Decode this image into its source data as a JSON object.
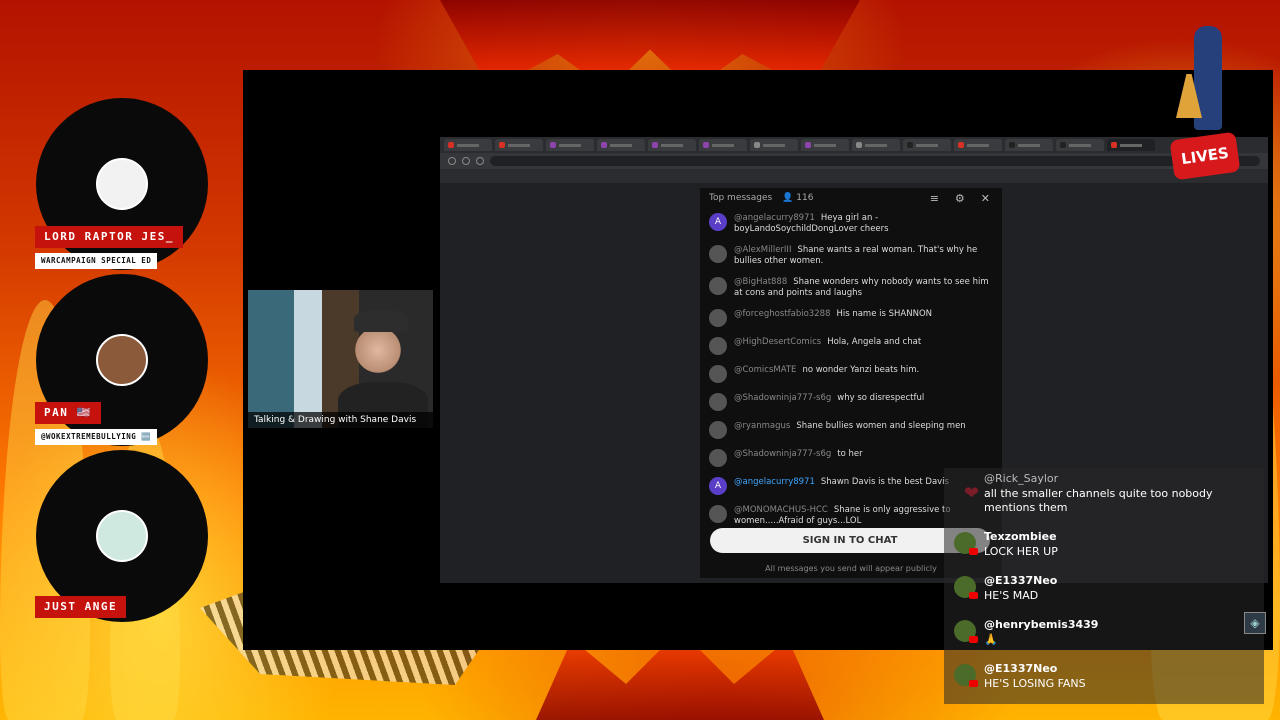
{
  "stream": {
    "browser_tabs": 16,
    "webcam_caption": "Talking & Drawing with Shane Davis",
    "lives_badge": "LIVES"
  },
  "yt_chat": {
    "header_title": "Top messages",
    "viewer_count": "116",
    "messages": [
      {
        "avatar": "A",
        "author": "@angelacurry8971",
        "text": "Heya girl an -boyLandoSoychildDongLover cheers",
        "blue": false
      },
      {
        "avatar": "",
        "author": "@AlexMillerIII",
        "text": "Shane wants a real woman. That's why he bullies other women.",
        "blue": false
      },
      {
        "avatar": "",
        "author": "@BigHat888",
        "text": "Shane wonders why nobody wants to see him at cons and points and laughs",
        "blue": false
      },
      {
        "avatar": "",
        "author": "@forceghostfabio3288",
        "text": "His name is SHANNON",
        "blue": false
      },
      {
        "avatar": "",
        "author": "@HighDesertComics",
        "text": "Hola, Angela and chat",
        "blue": false
      },
      {
        "avatar": "",
        "author": "@ComicsMATE",
        "text": "no wonder Yanzi beats him.",
        "blue": false
      },
      {
        "avatar": "",
        "author": "@Shadowninja777-s6g",
        "text": "why so disrespectful",
        "blue": false
      },
      {
        "avatar": "",
        "author": "@ryanmagus",
        "text": "Shane bullies women and sleeping men",
        "blue": false
      },
      {
        "avatar": "",
        "author": "@Shadowninja777-s6g",
        "text": "to her",
        "blue": false
      },
      {
        "avatar": "A",
        "author": "@angelacurry8971",
        "text": "Shawn Davis is the best Davis",
        "blue": true
      },
      {
        "avatar": "",
        "author": "@MONOMACHUS-HCC",
        "text": "Shane is only aggressive to women.....Afraid of guys...LOL",
        "blue": false
      }
    ],
    "sign_in_label": "SIGN IN TO CHAT",
    "sign_in_note": "All messages you send will appear publicly"
  },
  "guests": [
    {
      "name": "LORD RAPTOR JES_",
      "sub": "WARCAMPAIGN SPECIAL ED",
      "avatar_color": "#f2f2f2"
    },
    {
      "name": "PAN 🇺🇸",
      "sub": "@WOKEXTREMEBULLYING 🆕",
      "avatar_color": "#8a5a3a"
    },
    {
      "name": "JUST ANGE",
      "sub": "",
      "avatar_color": "#cfe8e0"
    }
  ],
  "overlay_chat": [
    {
      "user": "@Rick_Saylor",
      "text": "all the smaller channels quite too nobody mentions them",
      "dim": true
    },
    {
      "user": "Texzombiee",
      "text": "LOCK HER UP",
      "dim": false
    },
    {
      "user": "@E1337Neo",
      "text": "HE'S MAD",
      "dim": false
    },
    {
      "user": "@henrybemis3439",
      "text": "🙏",
      "dim": false
    },
    {
      "user": "@E1337Neo",
      "text": "HE'S LOSING FANS",
      "dim": false
    }
  ],
  "colors": {
    "nameplate": "#c6120c",
    "accent_red": "#e0102a",
    "chat_bg": "#0f0f0f"
  },
  "icons": [
    "heart-icon",
    "broom-mascot-icon",
    "lives-badge",
    "stream-logo-icon",
    "close-icon",
    "settings-icon",
    "people-icon"
  ]
}
